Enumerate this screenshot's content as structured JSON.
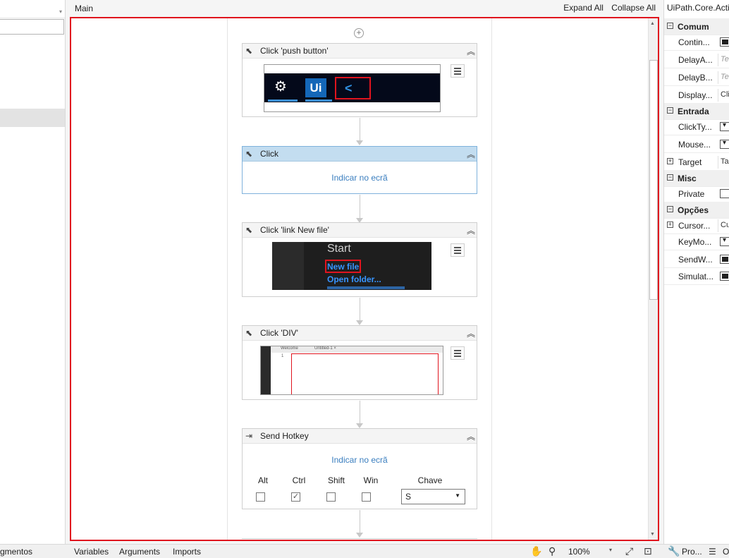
{
  "left_panel": {
    "bottom_tab": "gmentos"
  },
  "designer": {
    "breadcrumb": "Main",
    "expand_all": "Expand All",
    "collapse_all": "Collapse All",
    "activities": [
      {
        "title": "Click 'push button'",
        "icon": "cursor-icon"
      },
      {
        "title": "Click",
        "icon": "cursor-icon",
        "indicate": "Indicar no ecrã"
      },
      {
        "title": "Click 'link  New file'",
        "icon": "cursor-icon"
      },
      {
        "title": "Click 'DIV'",
        "icon": "cursor-icon"
      },
      {
        "title": "Send Hotkey",
        "icon": "send-hotkey-icon",
        "indicate": "Indicar no ecrã"
      }
    ],
    "screenshot1": {
      "app_label": "Ui"
    },
    "screenshot3": {
      "heading": "Start",
      "new_file": "New file",
      "open_folder": "Open folder..."
    },
    "screenshot4": {
      "tab1": "Welcome",
      "tab2": "Untitled-1 ×",
      "line_no": "1"
    },
    "hotkey": {
      "labels": {
        "alt": "Alt",
        "ctrl": "Ctrl",
        "shift": "Shift",
        "win": "Win",
        "key": "Chave"
      },
      "alt_checked": false,
      "ctrl_checked": true,
      "shift_checked": false,
      "win_checked": false,
      "key_value": "S"
    }
  },
  "bottom_bar": {
    "variables": "Variables",
    "arguments": "Arguments",
    "imports": "Imports",
    "zoom": "100%",
    "props_tab": "Pro...",
    "other_tab": "O"
  },
  "properties": {
    "title": "UiPath.Core.Activ",
    "rows": [
      {
        "kind": "cat",
        "name": "Comum"
      },
      {
        "kind": "prop",
        "name": "Contin...",
        "value_type": "checkbox-filled"
      },
      {
        "kind": "prop",
        "name": "DelayA...",
        "value": "Te",
        "value_type": "text-placeholder"
      },
      {
        "kind": "prop",
        "name": "DelayB...",
        "value": "Te",
        "value_type": "text-placeholder"
      },
      {
        "kind": "prop",
        "name": "Display...",
        "value": "Cli",
        "value_type": "text"
      },
      {
        "kind": "cat",
        "name": "Entrada"
      },
      {
        "kind": "prop",
        "name": "ClickTy...",
        "value_type": "dropdown"
      },
      {
        "kind": "prop",
        "name": "Mouse...",
        "value_type": "dropdown"
      },
      {
        "kind": "expand",
        "name": "Target",
        "value": "Tar",
        "value_type": "text"
      },
      {
        "kind": "cat",
        "name": "Misc"
      },
      {
        "kind": "prop",
        "name": "Private",
        "value_type": "checkbox-empty"
      },
      {
        "kind": "cat",
        "name": "Opções"
      },
      {
        "kind": "expand",
        "name": "Cursor...",
        "value": "Cu",
        "value_type": "text"
      },
      {
        "kind": "prop",
        "name": "KeyMo...",
        "value_type": "dropdown"
      },
      {
        "kind": "prop",
        "name": "SendW...",
        "value_type": "checkbox-filled"
      },
      {
        "kind": "prop",
        "name": "Simulat...",
        "value_type": "checkbox-filled"
      }
    ]
  },
  "colors": {
    "selection_border": "#e0141e",
    "selected_header": "#c3ddf0",
    "link_blue": "#3a7ebf"
  }
}
